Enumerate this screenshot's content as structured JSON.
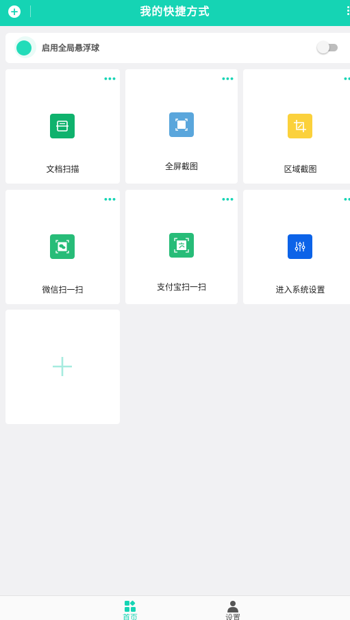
{
  "header": {
    "title": "我的快捷方式",
    "add_icon": "plus-circle-icon",
    "more_icon": "more-vertical-icon"
  },
  "floating_ball": {
    "label": "启用全局悬浮球",
    "enabled": false
  },
  "tiles": [
    {
      "label": "文档扫描",
      "icon": "document-scan-icon",
      "color": "#0fb26d"
    },
    {
      "label": "全屏截图",
      "icon": "fullscreen-capture-icon",
      "color": "#5aa6dc"
    },
    {
      "label": "区域截图",
      "icon": "crop-icon",
      "color": "#fbd13c"
    },
    {
      "label": "微信扫一扫",
      "icon": "wechat-scan-icon",
      "color": "#27bc78"
    },
    {
      "label": "支付宝扫一扫",
      "icon": "alipay-scan-icon",
      "color": "#27bc78"
    },
    {
      "label": "进入系统设置",
      "icon": "sliders-icon",
      "color": "#0c63e8"
    }
  ],
  "add_tile": {
    "icon": "plus-icon"
  },
  "nav": {
    "home": {
      "label": "首页",
      "icon": "grid-icon",
      "active": true
    },
    "settings": {
      "label": "设置",
      "icon": "person-icon",
      "active": false
    }
  },
  "colors": {
    "accent": "#15d4b4",
    "background": "#f1f1f3"
  }
}
